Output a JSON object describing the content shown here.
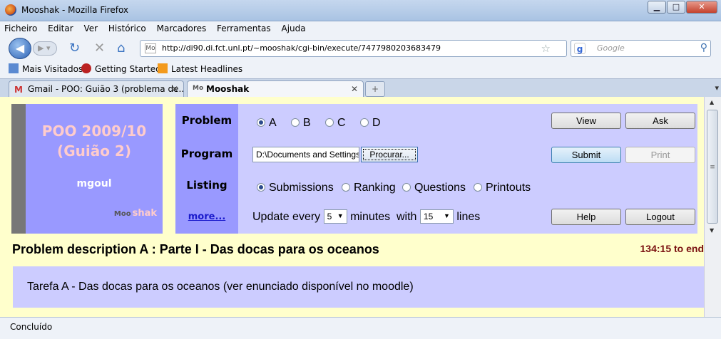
{
  "window": {
    "title": "Mooshak - Mozilla Firefox",
    "minimize": "▁",
    "maximize": "□",
    "close": "✕"
  },
  "menu": [
    "Ficheiro",
    "Editar",
    "Ver",
    "Histórico",
    "Marcadores",
    "Ferramentas",
    "Ajuda"
  ],
  "nav": {
    "url": "http://di90.di.fct.unl.pt/~mooshak/cgi-bin/execute/7477980203683479",
    "search_placeholder": "Google",
    "search_engine_letter": "g"
  },
  "bookmarks": [
    "Mais Visitados",
    "Getting Started",
    "Latest Headlines"
  ],
  "tabs": [
    {
      "label": "Gmail - POO: Guião 3 (problema de...",
      "icon": "gmail-icon",
      "active": false
    },
    {
      "label": "Mooshak",
      "icon": "mooshak-icon",
      "active": true
    }
  ],
  "sidebar": {
    "course_line1": "POO 2009/10",
    "course_line2": "(Guião 2)",
    "user": "mgoul",
    "logo_text": "shak",
    "logo_prefix": "Moo"
  },
  "labels": {
    "problem": "Problem",
    "program": "Program",
    "listing": "Listing",
    "more": "more..."
  },
  "problems": [
    {
      "label": "A",
      "selected": true
    },
    {
      "label": "B",
      "selected": false
    },
    {
      "label": "C",
      "selected": false
    },
    {
      "label": "D",
      "selected": false
    }
  ],
  "program": {
    "file_value": "D:\\Documents and Settings",
    "browse_label": "Procurar..."
  },
  "listing_options": [
    {
      "label": "Submissions",
      "selected": true
    },
    {
      "label": "Ranking",
      "selected": false
    },
    {
      "label": "Questions",
      "selected": false
    },
    {
      "label": "Printouts",
      "selected": false
    }
  ],
  "update": {
    "prefix": "Update every",
    "minutes_value": "5",
    "minutes_label": "minutes",
    "with_label": "with",
    "lines_value": "15",
    "lines_label": "lines"
  },
  "buttons": {
    "view": "View",
    "ask": "Ask",
    "submit": "Submit",
    "print": "Print",
    "help": "Help",
    "logout": "Logout"
  },
  "problem_title": "Problem description A : Parte I - Das docas para os oceanos",
  "timer": "134:15 to end",
  "description": "Tarefa A - Das docas para os oceanos (ver enunciado disponível no moodle)",
  "status": "Concluído",
  "colors": {
    "page_bg": "#ffffcc",
    "panel_dark": "#9999ff",
    "panel_light": "#ccccff",
    "course_text": "#ffcccc",
    "timer": "#7a1010"
  }
}
